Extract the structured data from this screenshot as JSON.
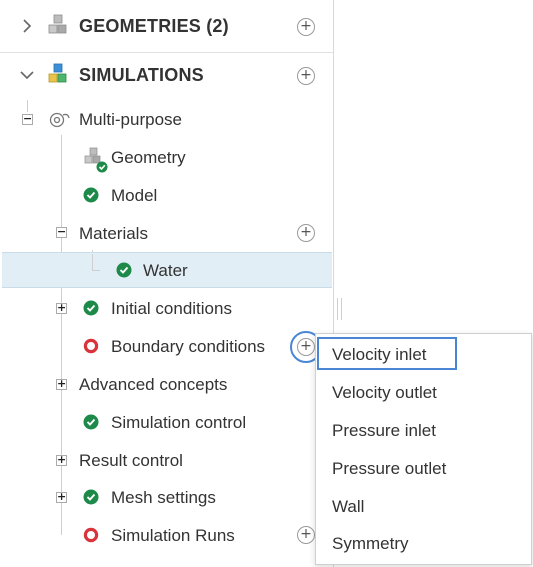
{
  "colors": {
    "success": "#1e8a4a",
    "error": "#d9343c",
    "selection": "#e1eef6",
    "focus": "#4a86d4"
  },
  "tree": {
    "geometries_header": {
      "label": "GEOMETRIES (2)",
      "icon": "cubes-icon",
      "chevron": "chevron-right-icon",
      "add": "+"
    },
    "simulations_header": {
      "label": "SIMULATIONS",
      "icon": "cubes-colored-icon",
      "chevron": "chevron-down-icon",
      "add": "+"
    },
    "simulation": {
      "label": "Multi-purpose",
      "icon": "simulation-gear-icon",
      "toggle": "−"
    },
    "items": {
      "geometry": {
        "label": "Geometry",
        "icon": "geometry-check-icon"
      },
      "model": {
        "label": "Model",
        "status": "ok"
      },
      "materials": {
        "label": "Materials",
        "toggle": "−",
        "add": "+"
      },
      "water": {
        "label": "Water",
        "status": "ok"
      },
      "initial_conditions": {
        "label": "Initial conditions",
        "status": "ok",
        "toggle": "+"
      },
      "boundary_conditions": {
        "label": "Boundary conditions",
        "status": "error",
        "add": "+"
      },
      "advanced_concepts": {
        "label": "Advanced concepts",
        "toggle": "+"
      },
      "simulation_control": {
        "label": "Simulation control",
        "status": "ok"
      },
      "result_control": {
        "label": "Result control",
        "toggle": "+"
      },
      "mesh_settings": {
        "label": "Mesh settings",
        "status": "ok",
        "toggle": "+"
      },
      "simulation_runs": {
        "label": "Simulation Runs",
        "status": "error",
        "add": "+"
      }
    }
  },
  "context_menu": {
    "items": [
      "Velocity inlet",
      "Velocity outlet",
      "Pressure inlet",
      "Pressure outlet",
      "Wall",
      "Symmetry"
    ],
    "highlighted": "Velocity inlet"
  }
}
